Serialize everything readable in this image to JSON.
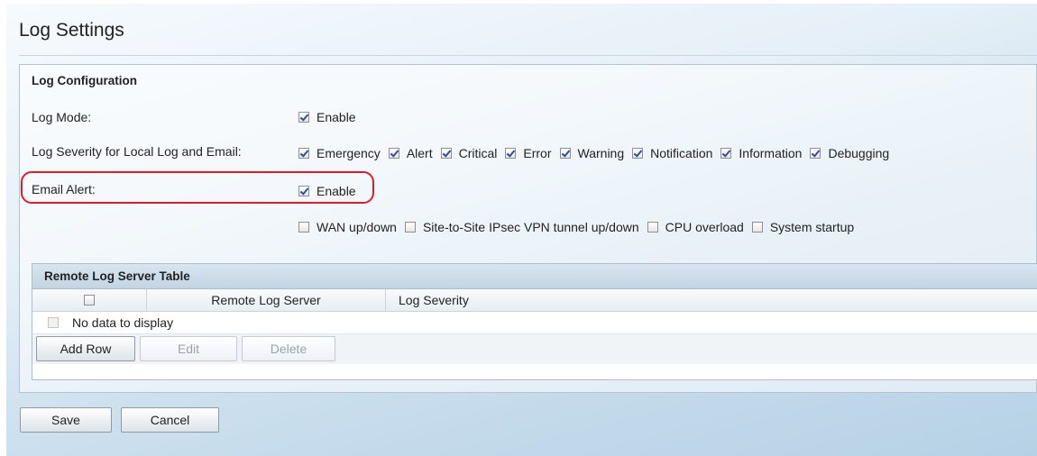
{
  "page": {
    "title": "Log Settings"
  },
  "log_config": {
    "section_title": "Log Configuration",
    "log_mode": {
      "label": "Log Mode:",
      "option": "Enable",
      "checked": true
    },
    "severity": {
      "label": "Log Severity for Local Log and Email:",
      "options": [
        {
          "label": "Emergency",
          "checked": true
        },
        {
          "label": "Alert",
          "checked": true
        },
        {
          "label": "Critical",
          "checked": true
        },
        {
          "label": "Error",
          "checked": true
        },
        {
          "label": "Warning",
          "checked": true
        },
        {
          "label": "Notification",
          "checked": true
        },
        {
          "label": "Information",
          "checked": true
        },
        {
          "label": "Debugging",
          "checked": true
        }
      ]
    },
    "email_alert": {
      "label": "Email Alert:",
      "option": "Enable",
      "checked": true
    },
    "alert_events": [
      {
        "label": "WAN up/down",
        "checked": false
      },
      {
        "label": "Site-to-Site IPsec VPN tunnel up/down",
        "checked": false
      },
      {
        "label": "CPU overload",
        "checked": false
      },
      {
        "label": "System startup",
        "checked": false
      }
    ]
  },
  "remote_table": {
    "title": "Remote Log Server Table",
    "columns": [
      "Remote Log Server",
      "Log Severity"
    ],
    "empty_text": "No data to display",
    "buttons": {
      "add": "Add Row",
      "edit": "Edit",
      "delete": "Delete"
    }
  },
  "footer": {
    "save": "Save",
    "cancel": "Cancel"
  },
  "colors": {
    "highlight": "#e01c28",
    "checkmark": "#2f4f9a"
  }
}
